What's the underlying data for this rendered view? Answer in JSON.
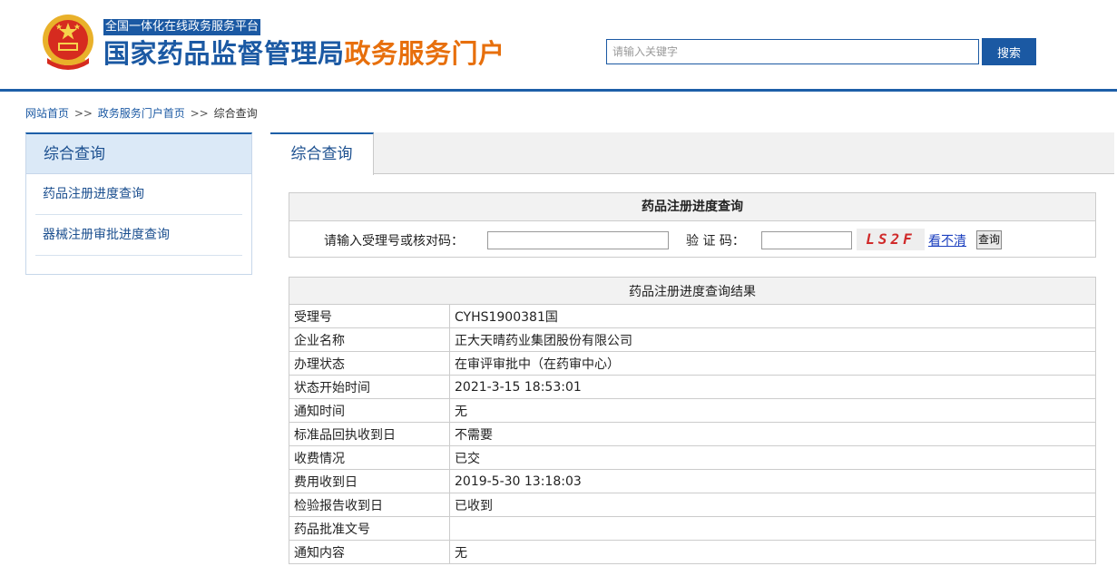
{
  "header": {
    "platform_tag": "全国一体化在线政务服务平台",
    "title_main": "国家药品监督管理局",
    "title_sub": "政务服务门户",
    "search_placeholder": "请输入关键字",
    "search_button": "搜索",
    "colors": {
      "brand_blue": "#1b59a3",
      "accent_orange": "#e76f0c"
    },
    "emblem_icon": "national-emblem-icon"
  },
  "breadcrumb": {
    "items": [
      "网站首页",
      "政务服务门户首页",
      "综合查询"
    ],
    "separator": ">>"
  },
  "sidebar": {
    "title": "综合查询",
    "items": [
      {
        "label": "药品注册进度查询"
      },
      {
        "label": "器械注册审批进度查询"
      }
    ]
  },
  "main": {
    "tab_label": "综合查询",
    "query": {
      "title": "药品注册进度查询",
      "accept_label": "请输入受理号或核对码：",
      "accept_value": "",
      "captcha_label": "验 证 码：",
      "captcha_value": "",
      "captcha_text": "LS2F",
      "refresh_link": "看不清",
      "submit_button": "查询"
    },
    "result": {
      "title": "药品注册进度查询结果",
      "rows": [
        {
          "key": "受理号",
          "value": "CYHS1900381国"
        },
        {
          "key": "企业名称",
          "value": "正大天晴药业集团股份有限公司"
        },
        {
          "key": "办理状态",
          "value": "在审评审批中（在药审中心）"
        },
        {
          "key": "状态开始时间",
          "value": "2021-3-15 18:53:01"
        },
        {
          "key": "通知时间",
          "value": "无"
        },
        {
          "key": "标准品回执收到日",
          "value": "不需要"
        },
        {
          "key": "收费情况",
          "value": "已交"
        },
        {
          "key": "费用收到日",
          "value": "2019-5-30 13:18:03"
        },
        {
          "key": "检验报告收到日",
          "value": "已收到"
        },
        {
          "key": "药品批准文号",
          "value": ""
        },
        {
          "key": "通知内容",
          "value": "无"
        }
      ]
    }
  }
}
